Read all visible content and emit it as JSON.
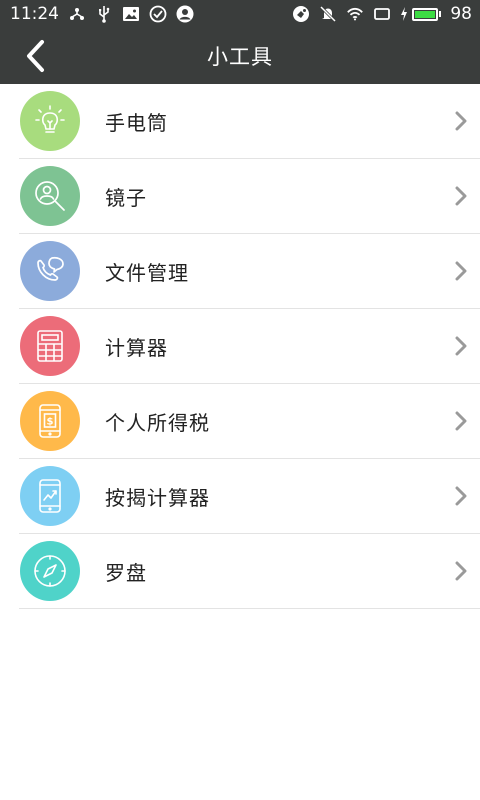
{
  "status_bar": {
    "time": "11:24",
    "battery_level": 98,
    "battery_text": "98",
    "battery_color": "#3ddc44"
  },
  "header": {
    "title": "小工具",
    "background": "#3a3d3c"
  },
  "tools": [
    {
      "label": "手电筒",
      "icon": "lightbulb-icon",
      "color": "#a8dc7e"
    },
    {
      "label": "镜子",
      "icon": "mirror-search-icon",
      "color": "#7ec393"
    },
    {
      "label": "文件管理",
      "icon": "phone-chat-icon",
      "color": "#8cabdb"
    },
    {
      "label": "计算器",
      "icon": "calculator-icon",
      "color": "#ec6c79"
    },
    {
      "label": "个人所得税",
      "icon": "tax-phone-icon",
      "color": "#ffb94a"
    },
    {
      "label": "按揭计算器",
      "icon": "mortgage-phone-icon",
      "color": "#7ecff3"
    },
    {
      "label": "罗盘",
      "icon": "compass-icon",
      "color": "#4fd3c9"
    }
  ]
}
